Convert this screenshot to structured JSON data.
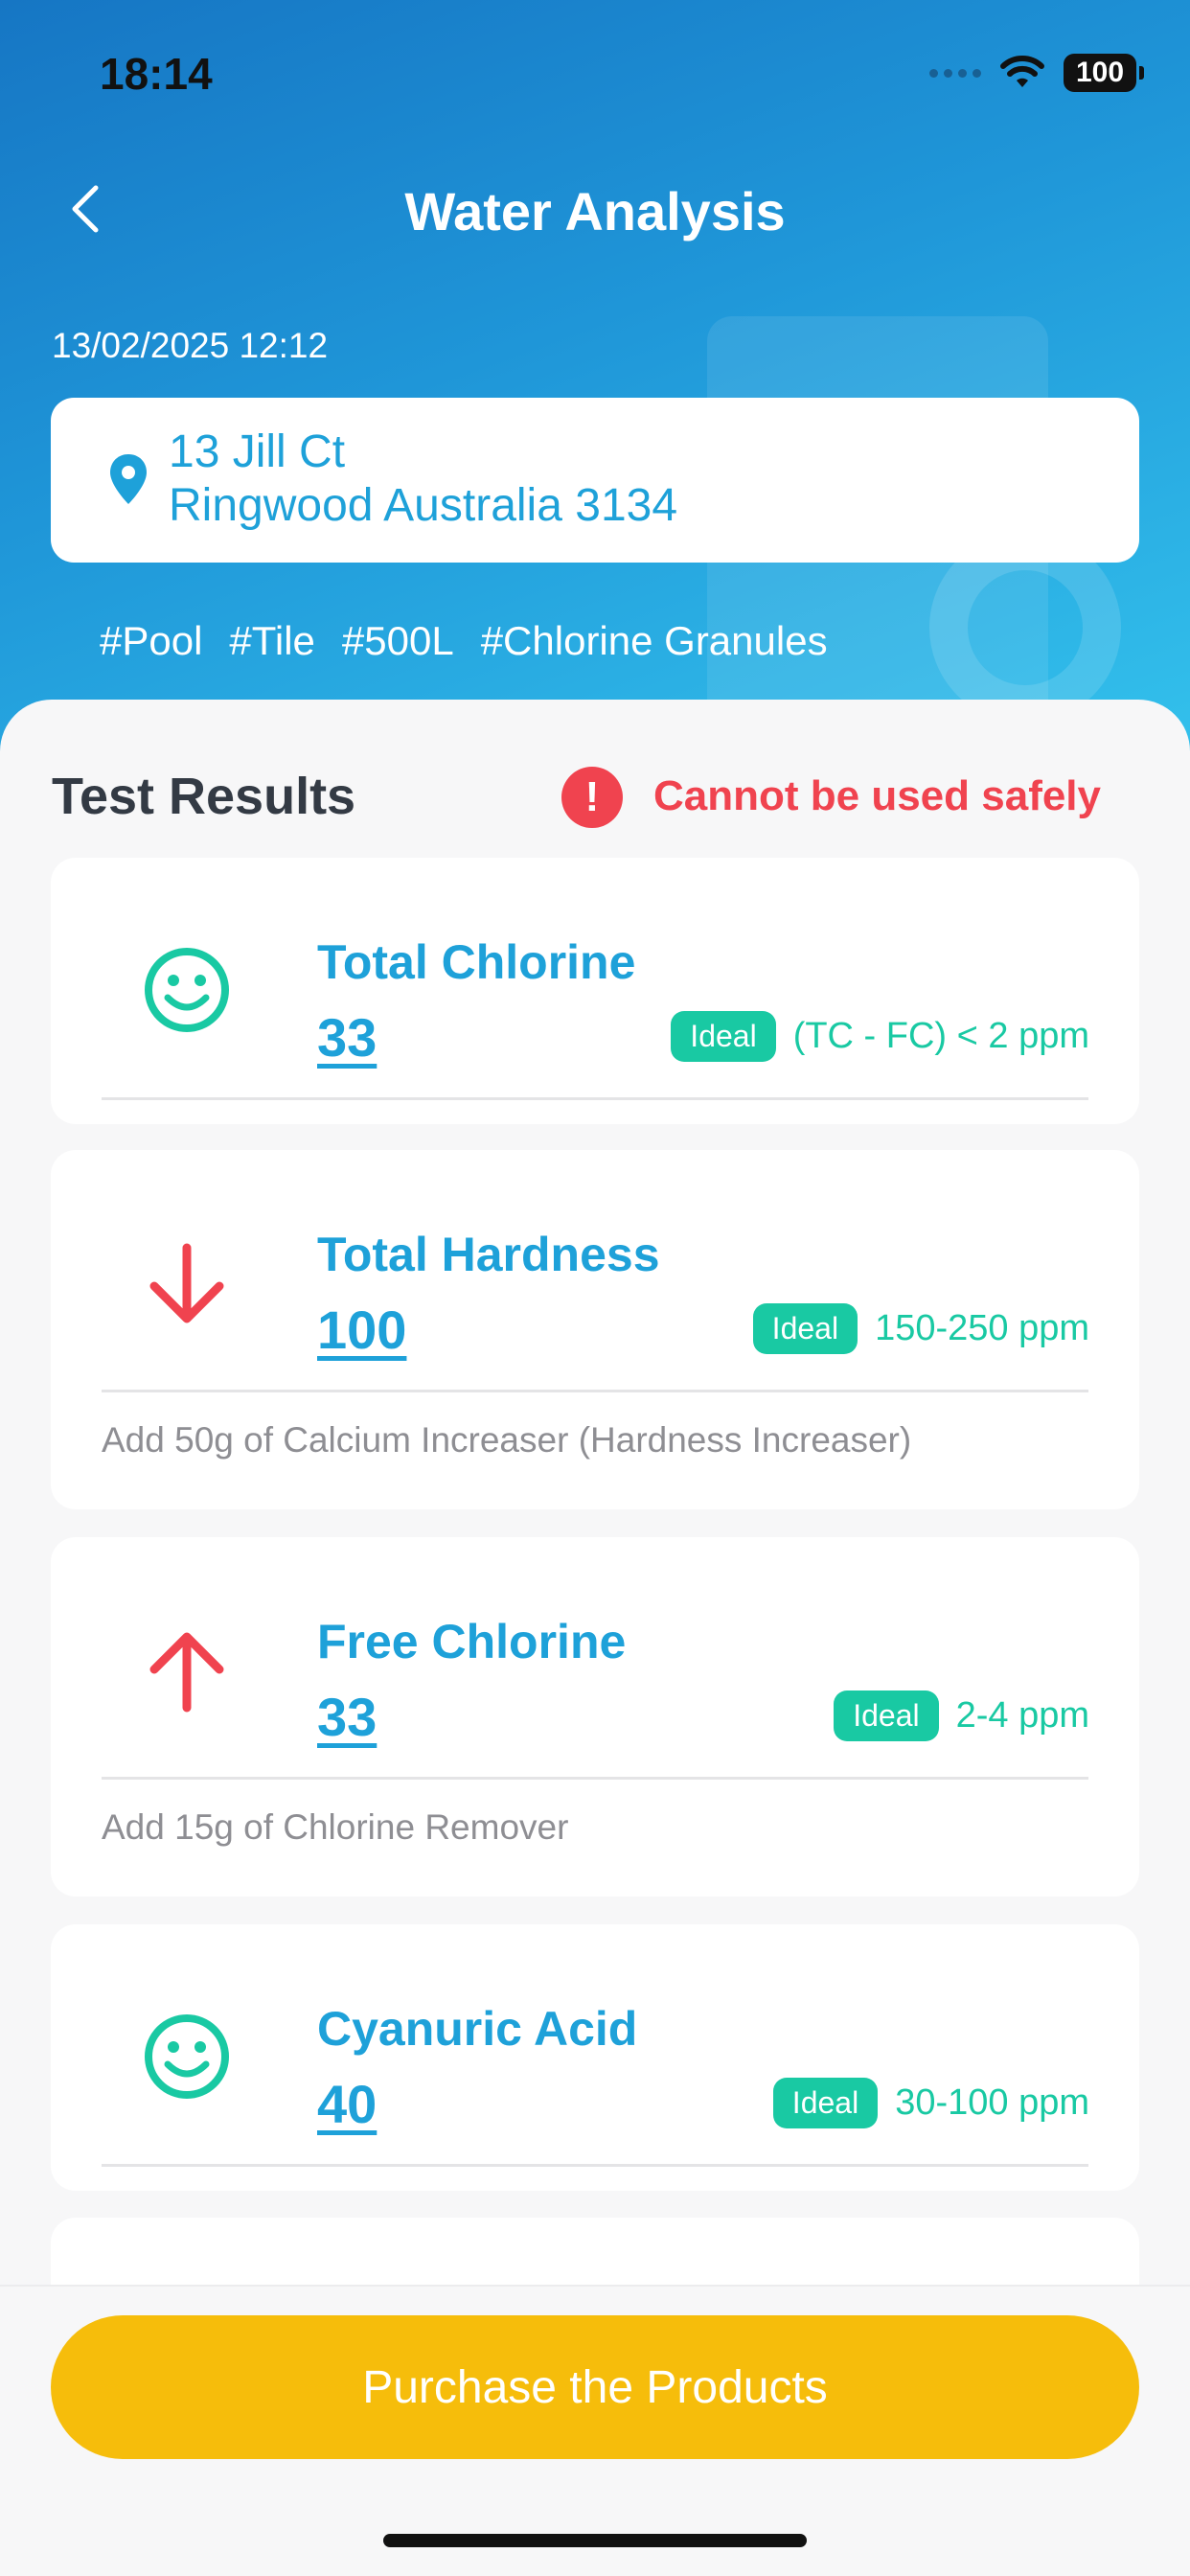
{
  "status_bar": {
    "time": "18:14",
    "battery": "100"
  },
  "header": {
    "title": "Water Analysis",
    "datetime": "13/02/2025 12:12",
    "address": {
      "line1": "13 Jill Ct",
      "line2": "Ringwood Australia 3134"
    },
    "tags": [
      "#Pool",
      "#Tile",
      "#500L",
      "#Chlorine Granules"
    ]
  },
  "results": {
    "title": "Test Results",
    "warning": "Cannot be used safely",
    "ideal_label": "Ideal",
    "items": [
      {
        "name": "Total Chlorine",
        "value": "33",
        "ideal": "(TC - FC) < 2 ppm",
        "icon": "smiley-icon",
        "advice": ""
      },
      {
        "name": "Total Hardness",
        "value": "100",
        "ideal": "150-250 ppm",
        "icon": "arrow-down-icon",
        "advice": "Add 50g of Calcium Increaser (Hardness Increaser)"
      },
      {
        "name": "Free Chlorine",
        "value": "33",
        "ideal": "2-4 ppm",
        "icon": "arrow-up-icon",
        "advice": "Add 15g of Chlorine Remover"
      },
      {
        "name": "Cyanuric Acid",
        "value": "40",
        "ideal": "30-100 ppm",
        "icon": "smiley-icon",
        "advice": ""
      }
    ]
  },
  "footer": {
    "button": "Purchase the Products"
  },
  "colors": {
    "accent": "#1ea1d9",
    "ideal": "#19c9a3",
    "warning": "#f0434f",
    "button": "#f6bd0b"
  }
}
